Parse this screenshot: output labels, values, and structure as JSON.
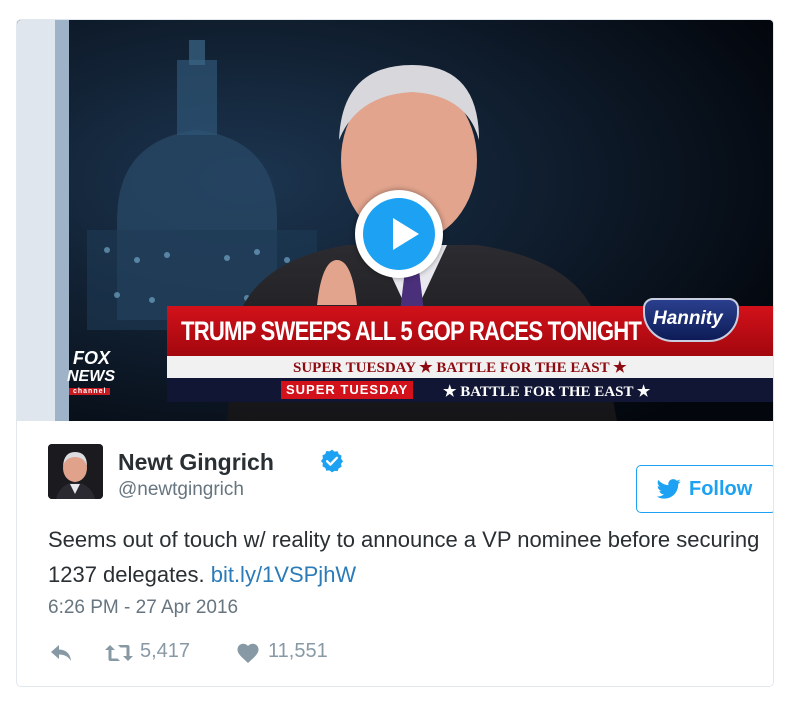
{
  "media": {
    "headline": "TRUMP SWEEPS ALL 5 GOP RACES TONIGHT",
    "show_name": "Hannity",
    "subline_1": "SUPER TUESDAY ★ BATTLE FOR THE EAST ★",
    "subline_2_tag": "SUPER TUESDAY",
    "subline_2_text": "★ BATTLE FOR THE EAST ★",
    "network_line1": "FOX",
    "network_line2": "NEWS",
    "network_line3": "channel"
  },
  "author": {
    "name": "Newt Gingrich",
    "handle": "@newtgingrich"
  },
  "follow_label": "Follow",
  "tweet": {
    "text": "Seems out of touch w/ reality to announce a VP nominee before securing 1237 delegates. ",
    "link": "bit.ly/1VSPjhW"
  },
  "timestamp": "6:26 PM - 27 Apr 2016",
  "actions": {
    "retweets": "5,417",
    "likes": "11,551"
  },
  "colors": {
    "accent": "#1da1f2",
    "link": "#2b7bb9",
    "text": "#292f33",
    "muted": "#66757f"
  }
}
